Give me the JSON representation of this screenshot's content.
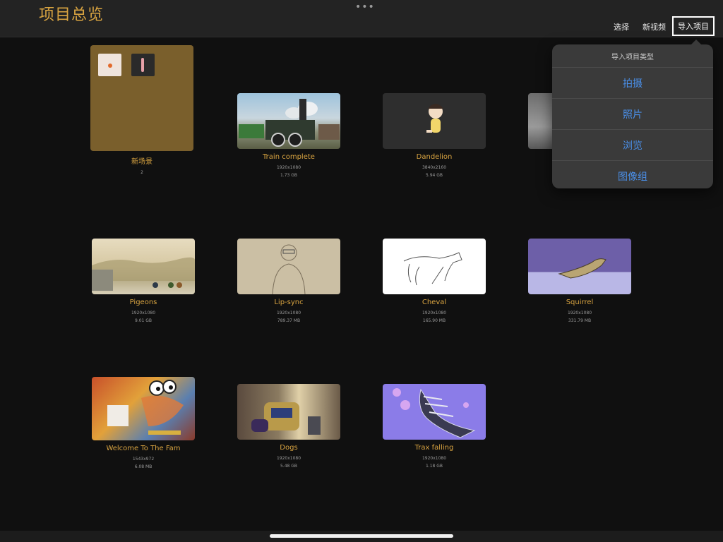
{
  "header": {
    "title": "项目总览",
    "dots": "•••",
    "select_label": "选择",
    "new_video_label": "新视频",
    "import_label": "导入项目"
  },
  "popover": {
    "title": "导入项目类型",
    "items": [
      "拍摄",
      "照片",
      "浏览",
      "图像组"
    ]
  },
  "projects": [
    {
      "name": "新场景",
      "meta1": "2",
      "meta2": ""
    },
    {
      "name": "Train complete",
      "meta1": "1920x1080",
      "meta2": "1.73 GB"
    },
    {
      "name": "Dandelion",
      "meta1": "3840x2160",
      "meta2": "5.94 GB"
    },
    {
      "name": "Pigeons",
      "meta1": "1920x1080",
      "meta2": "9.01 GB"
    },
    {
      "name": "Lip-sync",
      "meta1": "1920x1080",
      "meta2": "789.37 MB"
    },
    {
      "name": "Cheval",
      "meta1": "1920x1080",
      "meta2": "165.90 MB"
    },
    {
      "name": "Squirrel",
      "meta1": "1920x1080",
      "meta2": "331.79 MB"
    },
    {
      "name": "Welcome To The Fam",
      "meta1": "1543x972",
      "meta2": "6.08 MB"
    },
    {
      "name": "Dogs",
      "meta1": "1920x1080",
      "meta2": "5.48 GB"
    },
    {
      "name": "Trax falling",
      "meta1": "1920x1080",
      "meta2": "1.18 GB"
    }
  ],
  "colors": {
    "accent": "#d9a441",
    "link": "#4a8fe8",
    "background": "#101010"
  }
}
